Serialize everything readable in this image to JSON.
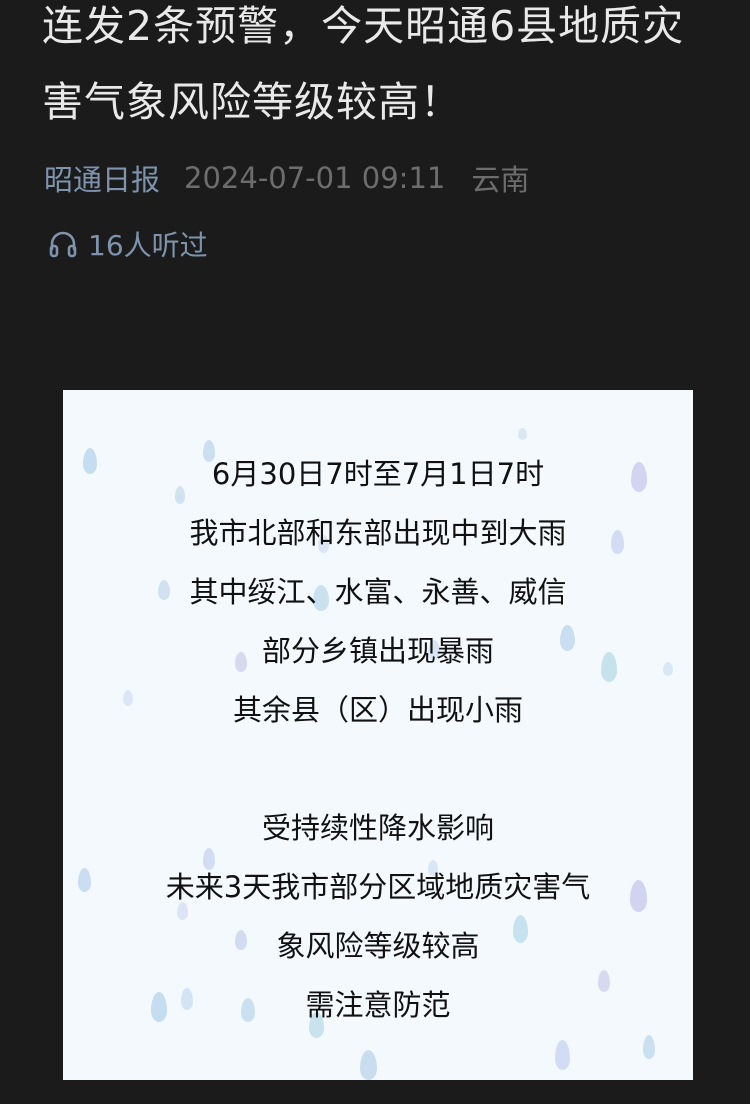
{
  "article": {
    "title": "连发2条预警，今天昭通6县地质灾害气象风险等级较高！",
    "source": "昭通日报",
    "datetime": "2024-07-01 09:11",
    "region": "云南",
    "listen_count": "16人听过",
    "listen_icon": "headphones-icon"
  },
  "card": {
    "background": "#f3f9fd",
    "decoration": "raindrops",
    "lines": [
      "6月30日7时至7月1日7时",
      "我市北部和东部出现中到大雨",
      "其中绥江、水富、永善、威信",
      "部分乡镇出现暴雨",
      "其余县（区）出现小雨",
      "",
      "受持续性降水影响",
      "未来3天我市部分区域地质灾害气",
      "象风险等级较高",
      "需注意防范"
    ]
  },
  "colors": {
    "background": "#1b1b1b",
    "title": "#e9e9e9",
    "source": "#7e93ad",
    "muted": "#6d6d6d",
    "card_text": "#111111"
  }
}
